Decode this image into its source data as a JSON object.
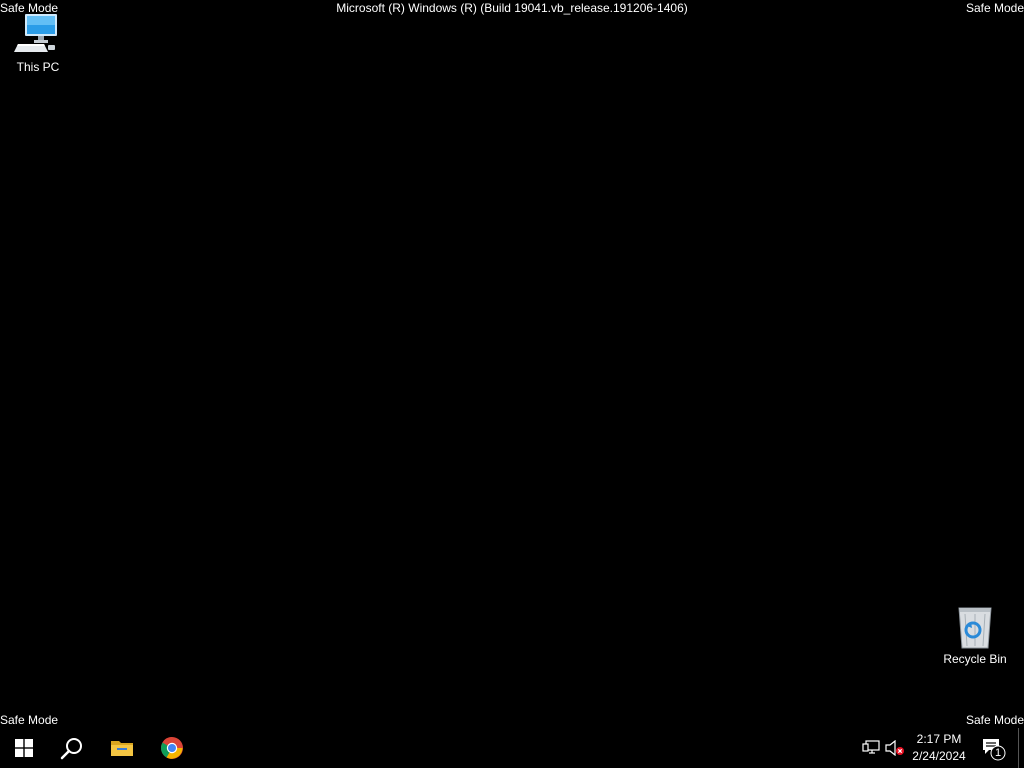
{
  "desktop": {
    "watermark": {
      "top_left": "Safe Mode",
      "top_right": "Safe Mode",
      "bottom_left": "Safe Mode",
      "bottom_right": "Safe Mode",
      "build": "Microsoft (R) Windows (R) (Build 19041.vb_release.191206-1406)"
    },
    "icons": [
      {
        "label": "This PC",
        "icon": "this-pc-icon"
      },
      {
        "label": "Recycle Bin",
        "icon": "recycle-bin-icon"
      }
    ]
  },
  "taskbar": {
    "pinned": [
      {
        "name": "Start",
        "icon": "windows-logo-icon"
      },
      {
        "name": "Search",
        "icon": "search-icon"
      },
      {
        "name": "File Explorer",
        "icon": "folder-icon"
      },
      {
        "name": "Google Chrome",
        "icon": "chrome-icon"
      }
    ],
    "tray": {
      "network_icon": "network-icon",
      "volume_icon": "volume-muted-icon",
      "time": "2:17 PM",
      "date": "2/24/2024",
      "notification_count": "1"
    }
  },
  "colors": {
    "background": "#000000",
    "text": "#ffffff",
    "folder_yellow": "#f4c542",
    "monitor_blue": "#4fb3f0"
  }
}
